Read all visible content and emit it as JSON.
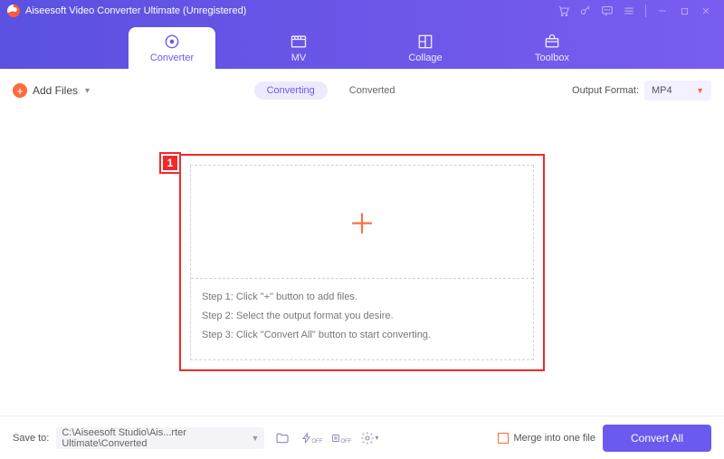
{
  "app": {
    "title": "Aiseesoft Video Converter Ultimate (Unregistered)"
  },
  "nav": {
    "converter": "Converter",
    "mv": "MV",
    "collage": "Collage",
    "toolbox": "Toolbox"
  },
  "toolbar": {
    "add_files": "Add Files",
    "tabs": {
      "converting": "Converting",
      "converted": "Converted"
    },
    "output_format_label": "Output Format:",
    "output_format_value": "MP4"
  },
  "annotation": {
    "badge": "1"
  },
  "instructions": {
    "step1": "Step 1: Click \"+\" button to add files.",
    "step2": "Step 2: Select the output format you desire.",
    "step3": "Step 3: Click \"Convert All\" button to start converting."
  },
  "footer": {
    "save_to_label": "Save to:",
    "save_to_path": "C:\\Aiseesoft Studio\\Ais...rter Ultimate\\Converted",
    "merge_label": "Merge into one file",
    "convert_all": "Convert All"
  }
}
